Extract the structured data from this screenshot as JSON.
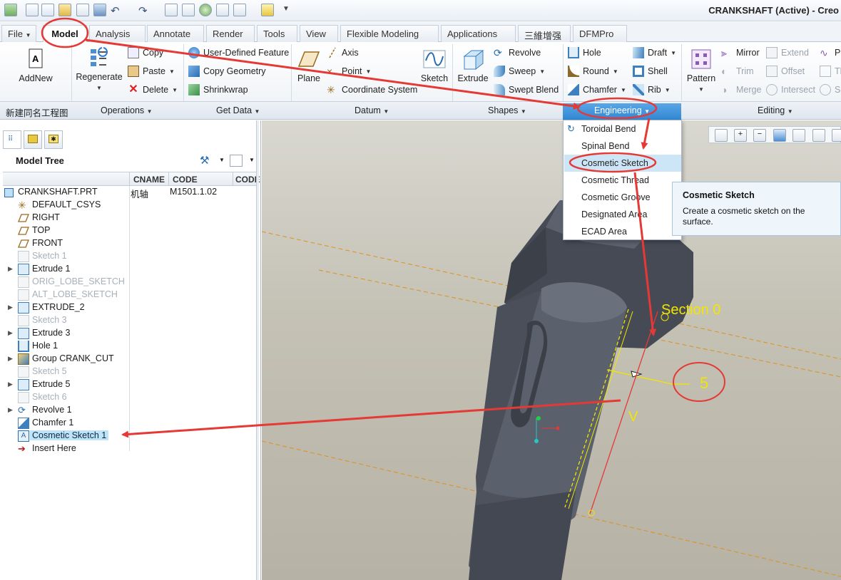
{
  "window": {
    "title": "CRANKSHAFT (Active) - Creo"
  },
  "tabs": [
    "File",
    "Model",
    "Analysis",
    "Annotate",
    "Render",
    "Tools",
    "View",
    "Flexible Modeling",
    "Applications",
    "三維增强",
    "DFMPro"
  ],
  "ribbon": {
    "addnew": "AddNew",
    "regenerate": "Regenerate",
    "copy": "Copy",
    "paste": "Paste",
    "delete": "Delete",
    "user_defined_feature": "User-Defined Feature",
    "copy_geometry": "Copy Geometry",
    "shrinkwrap": "Shrinkwrap",
    "plane": "Plane",
    "axis": "Axis",
    "point": "Point",
    "coordinate_system": "Coordinate System",
    "sketch": "Sketch",
    "extrude": "Extrude",
    "revolve": "Revolve",
    "sweep": "Sweep",
    "swept_blend": "Swept Blend",
    "hole": "Hole",
    "round": "Round",
    "chamfer": "Chamfer",
    "draft": "Draft",
    "shell": "Shell",
    "rib": "Rib",
    "pattern": "Pattern",
    "mirror": "Mirror",
    "extend": "Extend",
    "trim": "Trim",
    "offset": "Offset",
    "merge": "Merge",
    "intersect": "Intersect",
    "pr": "Pr",
    "th": "Th",
    "so": "So"
  },
  "groups": {
    "custom": "新建同名工程图",
    "operations": "Operations",
    "get_data": "Get Data",
    "datum": "Datum",
    "shapes": "Shapes",
    "engineering": "Engineering",
    "editing": "Editing"
  },
  "model_tree": {
    "title": "Model Tree",
    "columns": [
      "CNAME",
      "CODE",
      "CODE"
    ],
    "root": {
      "label": "CRANKSHAFT.PRT",
      "cname": "机轴",
      "code": "M1501.1.02"
    },
    "items": [
      {
        "label": "DEFAULT_CSYS"
      },
      {
        "label": "RIGHT"
      },
      {
        "label": "TOP"
      },
      {
        "label": "FRONT"
      },
      {
        "label": "Sketch 1"
      },
      {
        "label": "Extrude 1"
      },
      {
        "label": "ORIG_LOBE_SKETCH"
      },
      {
        "label": "ALT_LOBE_SKETCH"
      },
      {
        "label": "EXTRUDE_2"
      },
      {
        "label": "Sketch 3"
      },
      {
        "label": "Extrude 3"
      },
      {
        "label": "Hole 1"
      },
      {
        "label": "Group CRANK_CUT"
      },
      {
        "label": "Sketch 5"
      },
      {
        "label": "Extrude 5"
      },
      {
        "label": "Sketch 6"
      },
      {
        "label": "Revolve 1"
      },
      {
        "label": "Chamfer 1"
      },
      {
        "label": "Cosmetic Sketch 1"
      },
      {
        "label": "Insert Here"
      }
    ]
  },
  "engineering_menu": {
    "items": [
      "Toroidal Bend",
      "Spinal Bend",
      "Cosmetic Sketch",
      "Cosmetic Thread",
      "Cosmetic Groove",
      "Designated Area",
      "ECAD Area"
    ],
    "highlighted": "Cosmetic Sketch"
  },
  "tooltip": {
    "title": "Cosmetic Sketch",
    "description": "Create a cosmetic sketch on the surface."
  },
  "viewport": {
    "section_label": "Section 0",
    "dimension_value": "5",
    "v_label": "V"
  },
  "colors": {
    "accent": "#2f86d3",
    "annotation_red": "#e53935",
    "selection": "#bfe3f7",
    "sketch_yellow": "#f2e600"
  }
}
